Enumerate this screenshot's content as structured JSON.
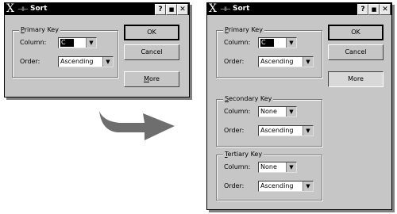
{
  "colors": {
    "dialog_bg": "#c6c6c6",
    "titlebar": "#000000",
    "arrow": "#6e6e6e"
  },
  "icons": {
    "app": "x-logo-icon",
    "pin": "pin-icon",
    "help": "help-icon",
    "maximize": "maximize-icon",
    "close": "close-icon",
    "dropdown": "chevron-down-icon",
    "transition": "arrow-right-icon"
  },
  "small_dialog": {
    "title": "Sort",
    "help_btn": "?",
    "max_btn": "■",
    "close_btn": "✕",
    "primary": {
      "label_u": "P",
      "label_rest": "rimary Key",
      "column_label": "Column:",
      "column_value": "C",
      "order_label": "Order:",
      "order_value": "Ascending"
    },
    "ok": "OK",
    "cancel": "Cancel",
    "more_u": "M",
    "more_rest": "ore"
  },
  "large_dialog": {
    "title": "Sort",
    "help_btn": "?",
    "max_btn": "■",
    "close_btn": "✕",
    "primary": {
      "label_u": "P",
      "label_rest": "rimary Key",
      "column_label": "Column:",
      "column_value": "C",
      "order_label": "Order:",
      "order_value": "Ascending"
    },
    "secondary": {
      "label_u": "S",
      "label_rest": "econdary Key",
      "column_label": "Column:",
      "column_value": "None",
      "order_label": "Order:",
      "order_value": "Ascending"
    },
    "tertiary": {
      "label_u": "T",
      "label_rest": "ertiary Key",
      "column_label": "Column:",
      "column_value": "None",
      "order_label": "Order:",
      "order_value": "Ascending"
    },
    "ok": "OK",
    "cancel": "Cancel",
    "more": "More"
  }
}
